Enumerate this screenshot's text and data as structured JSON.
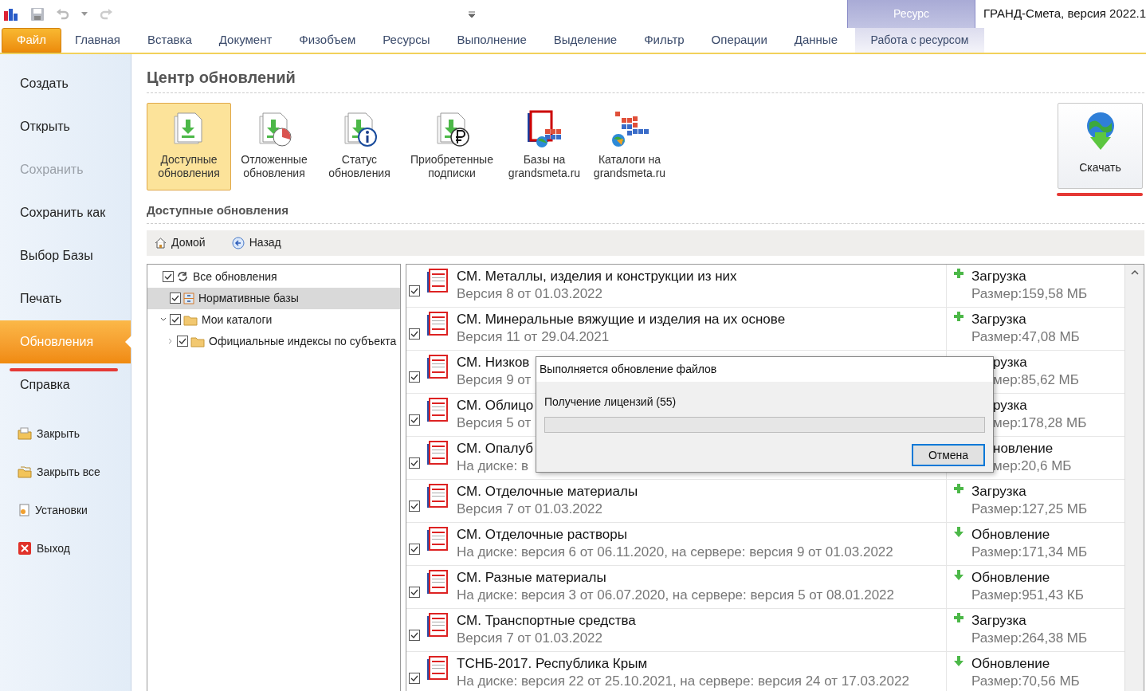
{
  "app_title": "ГРАНД-Смета, версия 2022.1",
  "ribbon": {
    "tabs": [
      {
        "label": "Файл",
        "kind": "file",
        "selected": true
      },
      {
        "label": "Главная",
        "kind": "normal",
        "selected": false
      },
      {
        "label": "Вставка",
        "kind": "normal",
        "selected": false
      },
      {
        "label": "Документ",
        "kind": "normal",
        "selected": false
      },
      {
        "label": "Физобъем",
        "kind": "normal",
        "selected": false
      },
      {
        "label": "Ресурсы",
        "kind": "normal",
        "selected": false
      },
      {
        "label": "Выполнение",
        "kind": "normal",
        "selected": false
      },
      {
        "label": "Выделение",
        "kind": "normal",
        "selected": false
      },
      {
        "label": "Фильтр",
        "kind": "normal",
        "selected": false
      },
      {
        "label": "Операции",
        "kind": "normal",
        "selected": false
      },
      {
        "label": "Данные",
        "kind": "normal",
        "selected": false
      },
      {
        "label": "Работа с ресурсом",
        "kind": "context",
        "selected": false
      }
    ],
    "context_group": "Ресурс"
  },
  "sidebar": {
    "items": [
      {
        "label": "Создать",
        "kind": "big",
        "disabled": false,
        "selected": false
      },
      {
        "label": "Открыть",
        "kind": "big",
        "disabled": false,
        "selected": false
      },
      {
        "label": "Сохранить",
        "kind": "big",
        "disabled": true,
        "selected": false
      },
      {
        "label": "Сохранить как",
        "kind": "big",
        "disabled": false,
        "selected": false
      },
      {
        "label": "Выбор Базы",
        "kind": "big",
        "disabled": false,
        "selected": false
      },
      {
        "label": "Печать",
        "kind": "big",
        "disabled": false,
        "selected": false
      },
      {
        "label": "Обновления",
        "kind": "big",
        "disabled": false,
        "selected": true
      },
      {
        "label": "Справка",
        "kind": "big",
        "disabled": false,
        "selected": false
      },
      {
        "label": "Закрыть",
        "kind": "folder",
        "disabled": false,
        "selected": false
      },
      {
        "label": "Закрыть все",
        "kind": "folders",
        "disabled": false,
        "selected": false
      },
      {
        "label": "Установки",
        "kind": "settings",
        "disabled": false,
        "selected": false
      },
      {
        "label": "Выход",
        "kind": "exit",
        "disabled": false,
        "selected": false
      }
    ]
  },
  "page_title": "Центр обновлений",
  "toolbar": [
    {
      "label": "Доступные обновления",
      "kind": "available",
      "selected": true
    },
    {
      "label": "Отложенные обновления",
      "kind": "delayed",
      "selected": false
    },
    {
      "label": "Статус обновления",
      "kind": "status",
      "selected": false
    },
    {
      "label": "Приобретенные подписки",
      "kind": "subscriptions",
      "selected": false
    },
    {
      "label": "Базы на grandsmeta.ru",
      "kind": "bases",
      "selected": false
    },
    {
      "label": "Каталоги на grandsmeta.ru",
      "kind": "catalogs",
      "selected": false
    }
  ],
  "download_button": "Скачать",
  "section_title": "Доступные обновления",
  "nav": [
    {
      "label": "Домой",
      "kind": "home"
    },
    {
      "label": "Назад",
      "kind": "back"
    }
  ],
  "tree": [
    {
      "label": "Все обновления",
      "kind": "refresh",
      "checked": true,
      "selected": false,
      "children": [
        {
          "label": "Нормативные базы",
          "kind": "cabinet",
          "checked": true,
          "selected": true
        },
        {
          "label": "Мои каталоги",
          "kind": "folder",
          "checked": true,
          "selected": false,
          "expanded": true,
          "children": [
            {
              "label": "Официальные индексы по субъекта",
              "kind": "folder",
              "checked": true,
              "selected": false,
              "expanded": false
            }
          ]
        }
      ]
    }
  ],
  "updates": [
    {
      "title": "СМ. Металлы, изделия и конструкции из них",
      "detail": "Версия 8 от 01.03.2022",
      "action": "Загрузка",
      "kind": "download",
      "size": "Размер:159,58 МБ",
      "checked": true,
      "covered": false
    },
    {
      "title": "СМ. Минеральные вяжущие и изделия на их основе",
      "detail": "Версия 11 от 29.04.2021",
      "action": "Загрузка",
      "kind": "download",
      "size": "Размер:47,08 МБ",
      "checked": true,
      "covered": false
    },
    {
      "title": "СМ. Низков",
      "detail": "Версия 9 от",
      "action": "рузка",
      "size": "мер:85,62 МБ",
      "checked": true,
      "covered": true
    },
    {
      "title": "СМ. Облицо",
      "detail": "Версия 5 от",
      "action": "рузка",
      "size": "мер:178,28 МБ",
      "checked": true,
      "covered": true
    },
    {
      "title": "СМ. Опалуб",
      "detail": "На диске: в",
      "action": "новление",
      "size": "мер:20,6 МБ",
      "checked": true,
      "covered": true
    },
    {
      "title": "СМ. Отделочные материалы",
      "detail": "Версия 7 от 01.03.2022",
      "action": "Загрузка",
      "kind": "download",
      "size": "Размер:127,25 МБ",
      "checked": true,
      "covered": false
    },
    {
      "title": "СМ. Отделочные растворы",
      "detail": "На диске: версия 6 от 06.11.2020, на сервере: версия 9 от 01.03.2022",
      "action": "Обновление",
      "kind": "update",
      "size": "Размер:171,34 МБ",
      "checked": true,
      "covered": false
    },
    {
      "title": "СМ. Разные материалы",
      "detail": "На диске: версия 3 от 06.07.2020, на сервере: версия 5 от 08.01.2022",
      "action": "Обновление",
      "kind": "update",
      "size": "Размер:951,43 КБ",
      "checked": true,
      "covered": false
    },
    {
      "title": "СМ. Транспортные средства",
      "detail": "Версия 7 от 01.03.2022",
      "action": "Загрузка",
      "kind": "download",
      "size": "Размер:264,38 МБ",
      "checked": true,
      "covered": false
    },
    {
      "title": "ТСНБ-2017. Республика Крым",
      "detail": "На диске: версия 22 от 25.10.2021, на сервере: версия 24 от 17.03.2022",
      "action": "Обновление",
      "kind": "update",
      "size": "Размер:70,56 МБ",
      "checked": true,
      "covered": false
    }
  ],
  "dialog": {
    "title": "Выполняется обновление файлов",
    "message": "Получение лицензий (55)",
    "progress": {
      "level": 0
    },
    "cancel": "Отмена"
  }
}
